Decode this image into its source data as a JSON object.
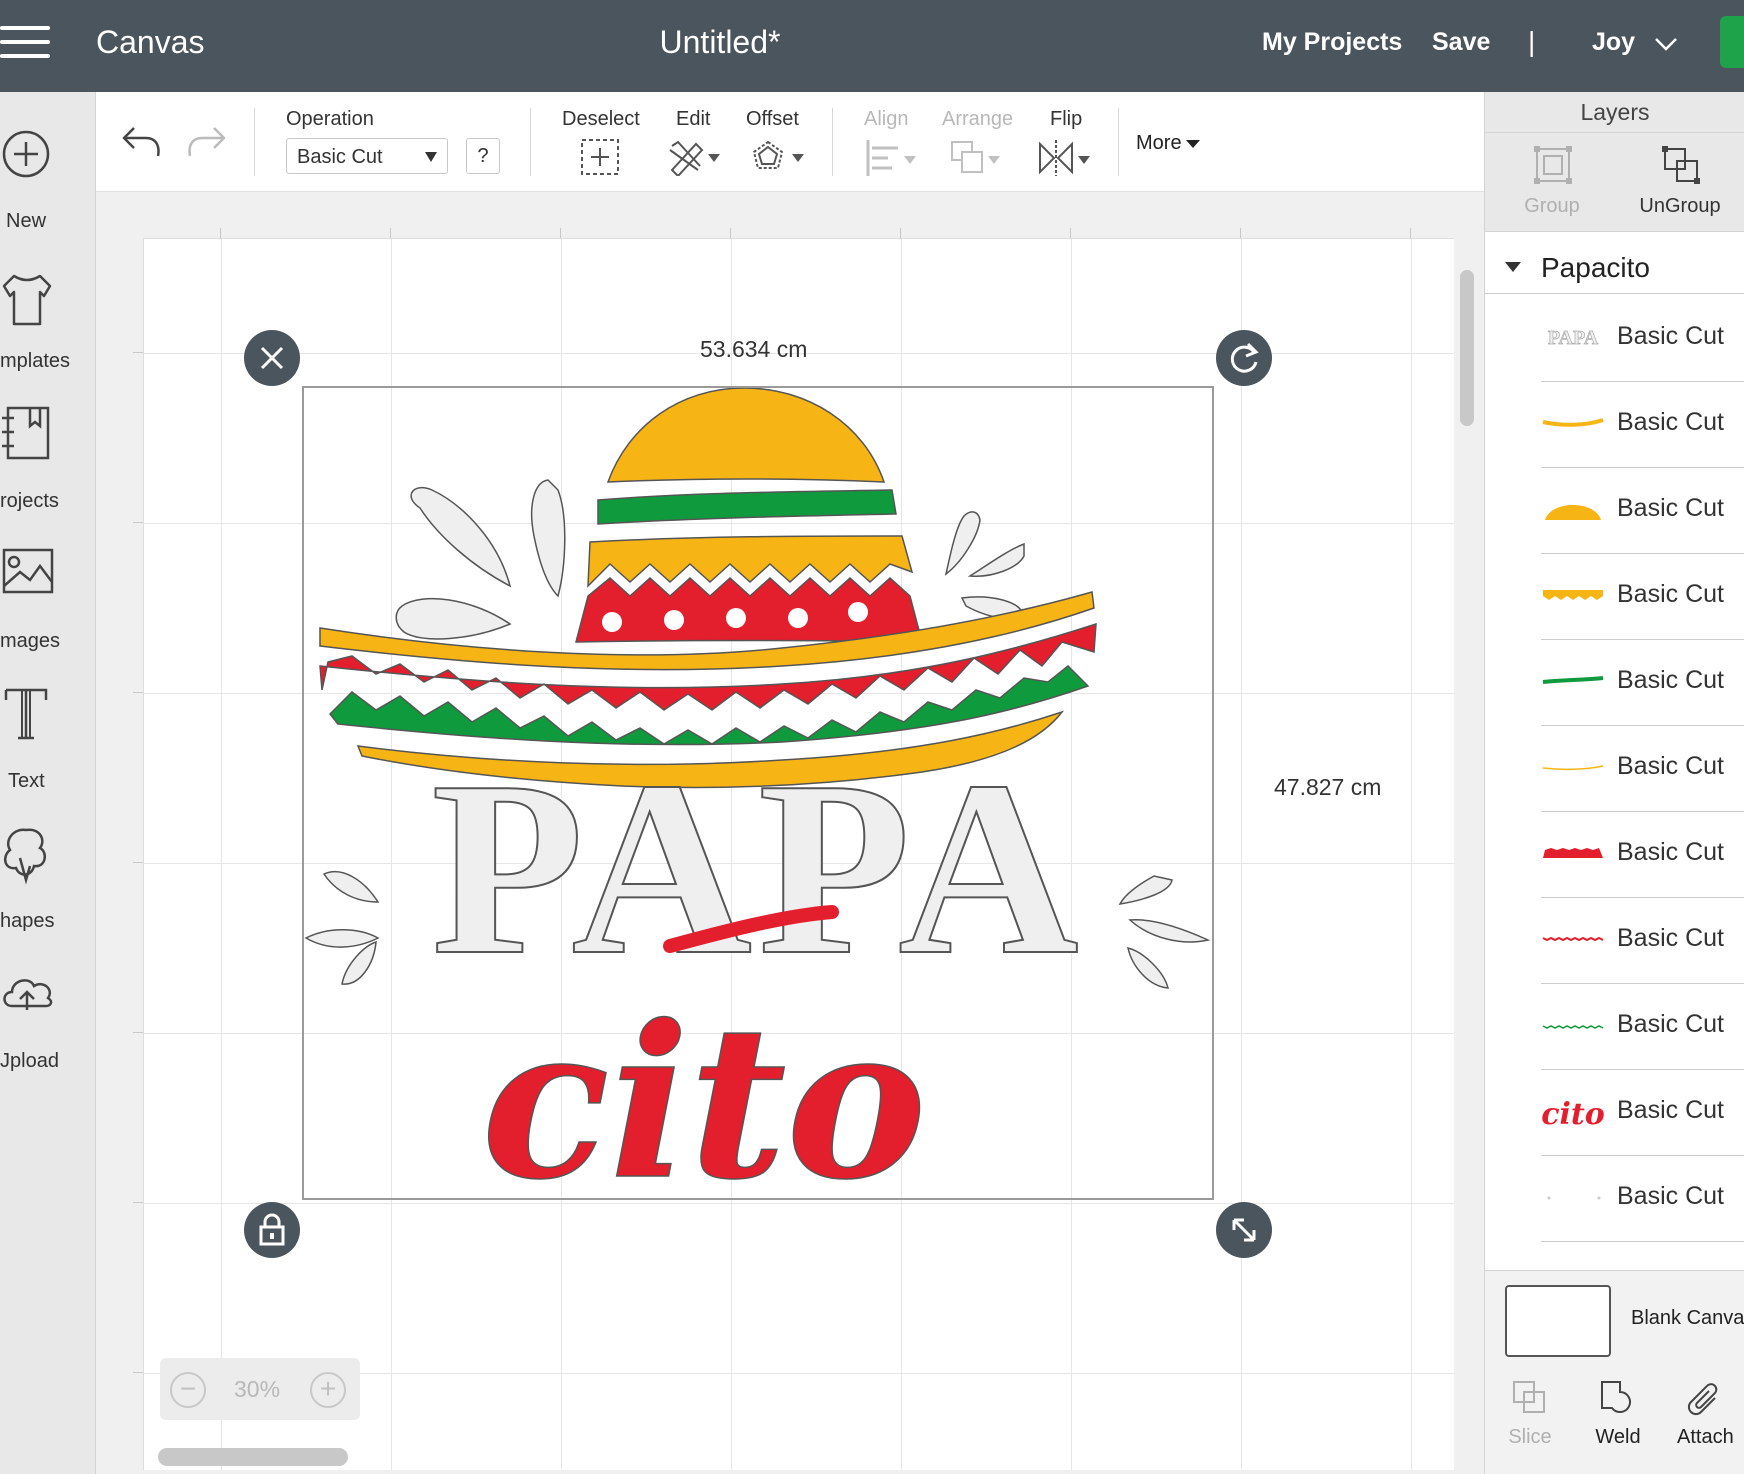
{
  "topbar": {
    "menu_icon": "hamburger-icon",
    "app_title": "Canvas",
    "doc_title": "Untitled*",
    "my_projects": "My Projects",
    "save": "Save",
    "separator": "|",
    "user": "Joy",
    "user_dropdown_icon": "chevron-down-icon",
    "colors": {
      "bar": "#4b555d",
      "make_button": "#1ea34a"
    }
  },
  "left_tools": [
    {
      "label": "New",
      "icon": "plus-circle-icon"
    },
    {
      "label": "mplates",
      "icon": "tshirt-icon"
    },
    {
      "label": "rojects",
      "icon": "notebook-icon"
    },
    {
      "label": "mages",
      "icon": "image-icon"
    },
    {
      "label": "Text",
      "icon": "text-t-icon"
    },
    {
      "label": "hapes",
      "icon": "shapes-icon"
    },
    {
      "label": "Jpload",
      "icon": "cloud-upload-icon"
    }
  ],
  "toolbar": {
    "undo_icon": "undo-icon",
    "redo_icon": "redo-icon",
    "operation_label": "Operation",
    "operation_value": "Basic Cut",
    "help": "?",
    "deselect": "Deselect",
    "edit": "Edit",
    "offset": "Offset",
    "align": "Align",
    "arrange": "Arrange",
    "flip": "Flip",
    "more": "More"
  },
  "canvas": {
    "width_label": "53.634 cm",
    "height_label": "47.827 cm",
    "zoom": "30%",
    "zoom_out": "−",
    "zoom_in": "+",
    "design_text_top": "PAPA",
    "design_text_bottom": "cito",
    "colors": {
      "yellow": "#f7b515",
      "green": "#0f9a3d",
      "red": "#e31e2d",
      "letters": "#efefef"
    }
  },
  "layers_panel": {
    "title": "Layers",
    "group": "Group",
    "ungroup": "UnGroup",
    "group_name": "Papacito",
    "items": [
      {
        "label": "Basic Cut",
        "thumb": "papa-letters"
      },
      {
        "label": "Basic Cut",
        "thumb": "yellow-thin-stripe"
      },
      {
        "label": "Basic Cut",
        "thumb": "yellow-dome"
      },
      {
        "label": "Basic Cut",
        "thumb": "yellow-zigzag"
      },
      {
        "label": "Basic Cut",
        "thumb": "green-stripe"
      },
      {
        "label": "Basic Cut",
        "thumb": "yellow-hairline"
      },
      {
        "label": "Basic Cut",
        "thumb": "red-dotted-band"
      },
      {
        "label": "Basic Cut",
        "thumb": "red-zigzag-line"
      },
      {
        "label": "Basic Cut",
        "thumb": "green-zigzag-line"
      },
      {
        "label": "Basic Cut",
        "thumb": "cito-script"
      },
      {
        "label": "Basic Cut",
        "thumb": "dots"
      }
    ],
    "blank_canvas": "Blank Canva",
    "slice": "Slice",
    "weld": "Weld",
    "attach": "Attach"
  }
}
